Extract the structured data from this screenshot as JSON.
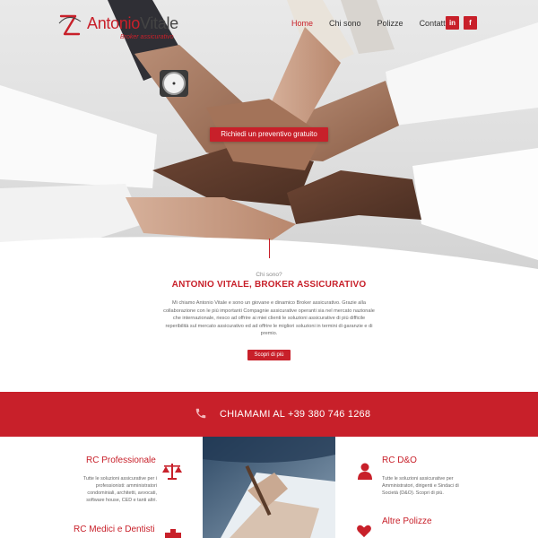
{
  "header": {
    "logo_first": "Antonio",
    "logo_second": "Vitale",
    "logo_sub": "Broker assicurativo",
    "nav": [
      {
        "label": "Home",
        "active": true
      },
      {
        "label": "Chi sono",
        "active": false
      },
      {
        "label": "Polizze",
        "active": false
      },
      {
        "label": "Contatti",
        "active": false
      }
    ],
    "social": {
      "linkedin": "in",
      "facebook": "f"
    }
  },
  "hero": {
    "cta_label": "Richiedi un preventivo gratuito"
  },
  "about": {
    "kicker": "Chi sono?",
    "title": "ANTONIO VITALE, BROKER ASSICURATIVO",
    "text": "Mi chiamo Antonio Vitale e sono un giovane e dinamico Broker assicurativo. Grazie alla collaborazione con le più importanti Compagnie assicurative operanti sia nel mercato nazionale che internazionale, riesco ad offrire ai miei clienti le soluzioni assicurative di più difficile reperibilità sul mercato assicurativo ed ad offrire le migliori soluzioni in termini di garanzie e di premio.",
    "button_label": "Scopri di più"
  },
  "callband": {
    "text": "CHIAMAMI AL +39 380 746 1268"
  },
  "services": {
    "rc_professionale": {
      "title": "RC Professionale",
      "text": "Tutte le soluzioni assicurative per i professionisti: amministratori condominiali, architetti, avvocati, software house, CED e tanti altri."
    },
    "rc_do": {
      "title": "RC D&O",
      "text": "Tutte le soluzioni assicurative per Amministratori, dirigenti e Sindaci di Società (D&O). Scopri di più."
    },
    "rc_medici": {
      "title": "RC Medici e Dentisti"
    },
    "altre_polizze": {
      "title": "Altre Polizze"
    }
  },
  "colors": {
    "brand_red": "#c8202a"
  },
  "icons": {
    "phone": "phone-icon",
    "scales": "scales-icon",
    "user": "user-icon",
    "heart": "heart-icon"
  }
}
